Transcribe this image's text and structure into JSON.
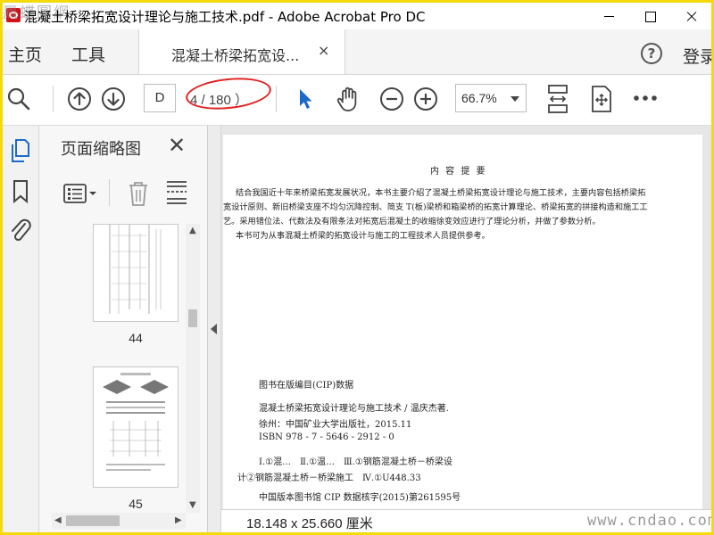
{
  "window": {
    "title": "混凝土桥梁拓宽设计理论与施工技术.pdf - Adobe Acrobat Pro DC",
    "watermark_top": "鳳蝶圖網"
  },
  "tabs": {
    "home": "主页",
    "tools": "工具",
    "document": "混凝土桥梁拓宽设...",
    "document_close": "×",
    "help": "?",
    "signin": "登录"
  },
  "toolbar": {
    "page_current": "D",
    "page_total": "4 / 180 ）",
    "zoom": "66.7%"
  },
  "thumbnails": {
    "title": "页面缩略图",
    "close": "✕",
    "pages": [
      {
        "label": "44"
      },
      {
        "label": "45"
      }
    ]
  },
  "document": {
    "abstract_title": "内 容 提 要",
    "abstract_lines": [
      "结合我国近十年来桥梁拓宽发展状况，本书主要介绍了混凝土桥梁拓宽设计理论与施工技术，主要内容包括桥梁拓",
      "宽设计原则、新旧桥梁支座不均匀沉降控制、简支 T(板)梁桥和箱梁桥的拓宽计算理论、桥梁拓宽的拼接构造和施工工",
      "艺。采用错位法、代数法及有限条法对拓宽后混凝土的收缩徐变效应进行了理论分析，并做了参数分析。",
      "本书可为从事混凝土桥梁的拓宽设计与施工的工程技术人员提供参考。"
    ],
    "cip": {
      "heading": "图书在版编目(CIP)数据",
      "line1": "混凝土桥梁拓宽设计理论与施工技术 / 温庆杰著.",
      "line2": "徐州：中国矿业大学出版社，2015.11",
      "line3": "ISBN 978 - 7 - 5646 - 2912 - 0",
      "line4": "Ⅰ.①混…　Ⅱ.①温…　Ⅲ.①钢筋混凝土桥－桥梁设",
      "line5": "计②钢筋混凝土桥－桥梁施工　Ⅳ.①U448.33",
      "line6": "中国版本图书馆 CIP 数据核字(2015)第261595号"
    }
  },
  "status": {
    "page_size": "18.148 x 25.660 厘米",
    "watermark": "www.cndao.com"
  }
}
